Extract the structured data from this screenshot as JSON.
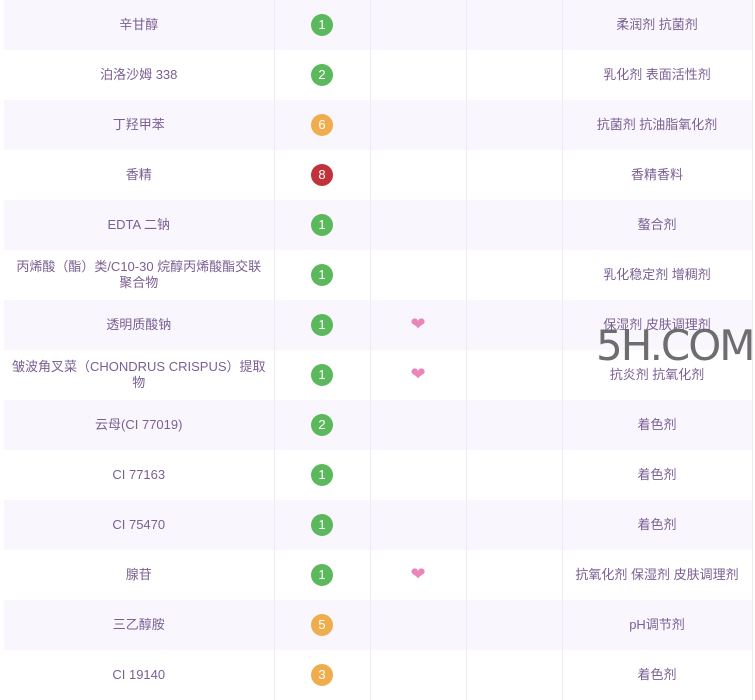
{
  "colors": {
    "low": "#5cb85c",
    "mid": "#f0ad4e",
    "high": "#c2323a",
    "heart": "#e985b9"
  },
  "rows": [
    {
      "name": "辛甘醇",
      "score": "1",
      "level": "low",
      "heart": false,
      "use": "柔润剂 抗菌剂"
    },
    {
      "name": "泊洛沙姆 338",
      "score": "2",
      "level": "low",
      "heart": false,
      "use": "乳化剂 表面活性剂"
    },
    {
      "name": "丁羟甲苯",
      "score": "6",
      "level": "mid",
      "heart": false,
      "use": "抗菌剂 抗油脂氧化剂"
    },
    {
      "name": "香精",
      "score": "8",
      "level": "high",
      "heart": false,
      "use": "香精香料"
    },
    {
      "name": "EDTA 二钠",
      "score": "1",
      "level": "low",
      "heart": false,
      "use": "螯合剂"
    },
    {
      "name": "丙烯酸（酯）类/C10-30 烷醇丙烯酸酯交联聚合物",
      "score": "1",
      "level": "low",
      "heart": false,
      "use": "乳化稳定剂 增稠剂"
    },
    {
      "name": "透明质酸钠",
      "score": "1",
      "level": "low",
      "heart": true,
      "use": "保湿剂 皮肤调理剂"
    },
    {
      "name": "皱波角叉菜（CHONDRUS CRISPUS）提取物",
      "score": "1",
      "level": "low",
      "heart": true,
      "use": "抗炎剂 抗氧化剂"
    },
    {
      "name": "云母(CI 77019)",
      "score": "2",
      "level": "low",
      "heart": false,
      "use": "着色剂"
    },
    {
      "name": "CI 77163",
      "score": "1",
      "level": "low",
      "heart": false,
      "use": "着色剂"
    },
    {
      "name": "CI 75470",
      "score": "1",
      "level": "low",
      "heart": false,
      "use": "着色剂"
    },
    {
      "name": "腺苷",
      "score": "1",
      "level": "low",
      "heart": true,
      "use": "抗氧化剂 保湿剂 皮肤调理剂"
    },
    {
      "name": "三乙醇胺",
      "score": "5",
      "level": "mid",
      "heart": false,
      "use": "pH调节剂"
    },
    {
      "name": "CI 19140",
      "score": "3",
      "level": "mid",
      "heart": false,
      "use": "着色剂"
    }
  ],
  "heart_icon": "heart-icon",
  "watermark": "5H.COM"
}
